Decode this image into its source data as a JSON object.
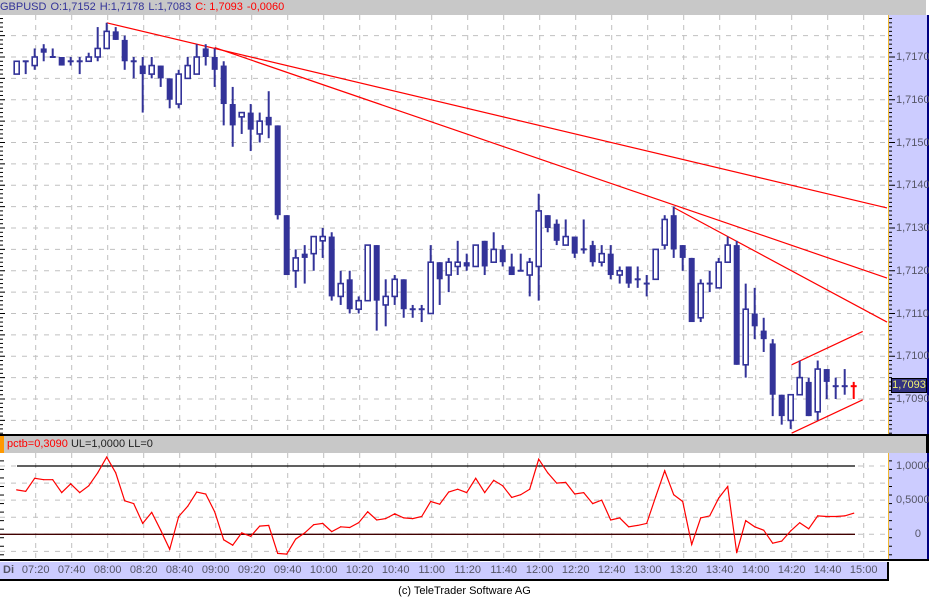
{
  "header": {
    "symbol": "GBPUSD",
    "open": "O:1,7152",
    "high": "H:1,7178",
    "low": "L:1,7083",
    "close": "C: 1,7093",
    "change": "-0,0060"
  },
  "price_axis": {
    "levels": [
      1.709,
      1.71,
      1.711,
      1.712,
      1.713,
      1.714,
      1.715,
      1.716,
      1.717
    ],
    "labels": [
      "1,7090",
      "1,7100",
      "1,7110",
      "1,7120",
      "1,7130",
      "1,7140",
      "1,7150",
      "1,7160",
      "1,7170"
    ],
    "current_value": 1.7093,
    "current_label": "1,7093"
  },
  "indicator": {
    "name_value": "pctb=0,3090",
    "params": "UL=1,0000 LL=0",
    "axis_levels": [
      1,
      0.5,
      0
    ],
    "axis_labels": [
      "1,0000",
      "0,5000",
      "0"
    ],
    "upper_limit": 1,
    "lower_limit": 0
  },
  "time_axis": {
    "day": "Di",
    "labels": [
      "07:20",
      "07:40",
      "08:00",
      "08:20",
      "08:40",
      "09:00",
      "09:20",
      "09:40",
      "10:00",
      "10:20",
      "10:40",
      "11:00",
      "11:20",
      "11:40",
      "12:00",
      "12:20",
      "12:40",
      "13:00",
      "13:20",
      "13:40",
      "14:00",
      "14:20",
      "14:40",
      "15:00"
    ]
  },
  "footer": "(c) TeleTrader Software AG",
  "colors": {
    "candle": "#333399",
    "last_candle": "#ff0000",
    "trendline": "#ff0000",
    "indicator_line": "#ff0000",
    "axis_bg": "#ccccff"
  },
  "chart_data": {
    "type": "candlestick",
    "symbol": "GBPUSD",
    "interval_minutes": 5,
    "first_bar_time": "07:10",
    "ylim": [
      1.708,
      1.7182
    ],
    "ohlc": [
      [
        1.7166,
        1.7169,
        1.7166,
        1.7169
      ],
      [
        1.7169,
        1.7169,
        1.7166,
        1.7169
      ],
      [
        1.7168,
        1.7172,
        1.7167,
        1.717
      ],
      [
        1.7172,
        1.7173,
        1.7169,
        1.7171
      ],
      [
        1.717,
        1.7172,
        1.717,
        1.717
      ],
      [
        1.717,
        1.717,
        1.7168,
        1.7168
      ],
      [
        1.7169,
        1.717,
        1.7168,
        1.7169
      ],
      [
        1.7169,
        1.717,
        1.7166,
        1.7169
      ],
      [
        1.7169,
        1.7171,
        1.7169,
        1.717
      ],
      [
        1.717,
        1.7177,
        1.7169,
        1.7172
      ],
      [
        1.7172,
        1.7178,
        1.7172,
        1.7176
      ],
      [
        1.7176,
        1.7177,
        1.7174,
        1.7174
      ],
      [
        1.7174,
        1.7175,
        1.7167,
        1.7169
      ],
      [
        1.7169,
        1.717,
        1.7165,
        1.7169
      ],
      [
        1.7168,
        1.717,
        1.7157,
        1.7166
      ],
      [
        1.7166,
        1.717,
        1.7165,
        1.7168
      ],
      [
        1.7168,
        1.7168,
        1.7163,
        1.7165
      ],
      [
        1.7165,
        1.7165,
        1.7158,
        1.716
      ],
      [
        1.7159,
        1.7167,
        1.7158,
        1.7166
      ],
      [
        1.7165,
        1.717,
        1.7165,
        1.7168
      ],
      [
        1.7166,
        1.7173,
        1.7166,
        1.717
      ],
      [
        1.7172,
        1.7173,
        1.7168,
        1.717
      ],
      [
        1.717,
        1.7172,
        1.7163,
        1.7167
      ],
      [
        1.7168,
        1.7169,
        1.7154,
        1.7159
      ],
      [
        1.7159,
        1.7163,
        1.7149,
        1.7154
      ],
      [
        1.7156,
        1.7157,
        1.7152,
        1.7157
      ],
      [
        1.7157,
        1.7159,
        1.7148,
        1.7153
      ],
      [
        1.7152,
        1.7157,
        1.715,
        1.7155
      ],
      [
        1.7156,
        1.7162,
        1.7151,
        1.7154
      ],
      [
        1.7154,
        1.7154,
        1.7132,
        1.7133
      ],
      [
        1.7133,
        1.7133,
        1.7119,
        1.7119
      ],
      [
        1.712,
        1.7125,
        1.7116,
        1.7123
      ],
      [
        1.7124,
        1.7126,
        1.7117,
        1.7123
      ],
      [
        1.7124,
        1.7128,
        1.712,
        1.7128
      ],
      [
        1.7127,
        1.713,
        1.7123,
        1.7128
      ],
      [
        1.7128,
        1.7129,
        1.7113,
        1.7114
      ],
      [
        1.7114,
        1.712,
        1.7112,
        1.7117
      ],
      [
        1.7118,
        1.712,
        1.711,
        1.7111
      ],
      [
        1.7111,
        1.7114,
        1.711,
        1.7113
      ],
      [
        1.7113,
        1.7126,
        1.7113,
        1.7126
      ],
      [
        1.7126,
        1.7126,
        1.7106,
        1.7113
      ],
      [
        1.7112,
        1.7118,
        1.7107,
        1.7114
      ],
      [
        1.7114,
        1.7119,
        1.7112,
        1.7118
      ],
      [
        1.7118,
        1.7118,
        1.7109,
        1.7111
      ],
      [
        1.7111,
        1.7112,
        1.7109,
        1.7111
      ],
      [
        1.7111,
        1.7112,
        1.7108,
        1.7111
      ],
      [
        1.711,
        1.7126,
        1.711,
        1.7122
      ],
      [
        1.7122,
        1.7122,
        1.7112,
        1.7118
      ],
      [
        1.7119,
        1.7123,
        1.7115,
        1.7122
      ],
      [
        1.7121,
        1.7127,
        1.7119,
        1.7122
      ],
      [
        1.7122,
        1.7124,
        1.712,
        1.7121
      ],
      [
        1.7121,
        1.7126,
        1.7121,
        1.7126
      ],
      [
        1.7127,
        1.7127,
        1.7119,
        1.7121
      ],
      [
        1.7122,
        1.7129,
        1.7122,
        1.7125
      ],
      [
        1.7125,
        1.7126,
        1.7121,
        1.7122
      ],
      [
        1.7121,
        1.7124,
        1.7119,
        1.7119
      ],
      [
        1.712,
        1.7124,
        1.712,
        1.712
      ],
      [
        1.7119,
        1.7123,
        1.7114,
        1.7122
      ],
      [
        1.7121,
        1.7138,
        1.7113,
        1.7134
      ],
      [
        1.7133,
        1.7133,
        1.7129,
        1.713
      ],
      [
        1.7131,
        1.7132,
        1.7126,
        1.7127
      ],
      [
        1.7126,
        1.7132,
        1.7126,
        1.7128
      ],
      [
        1.7128,
        1.7128,
        1.7123,
        1.7124
      ],
      [
        1.7125,
        1.7132,
        1.7124,
        1.7125
      ],
      [
        1.7126,
        1.7127,
        1.7121,
        1.7122
      ],
      [
        1.7122,
        1.7126,
        1.7121,
        1.7124
      ],
      [
        1.7124,
        1.7126,
        1.7118,
        1.7119
      ],
      [
        1.7119,
        1.7121,
        1.7117,
        1.712
      ],
      [
        1.7121,
        1.7121,
        1.7116,
        1.7117
      ],
      [
        1.7118,
        1.7121,
        1.7116,
        1.7118
      ],
      [
        1.7117,
        1.7119,
        1.7114,
        1.7117
      ],
      [
        1.7118,
        1.7125,
        1.7118,
        1.7125
      ],
      [
        1.7126,
        1.7133,
        1.7125,
        1.7132
      ],
      [
        1.7133,
        1.7135,
        1.7123,
        1.7125
      ],
      [
        1.7126,
        1.7126,
        1.712,
        1.7123
      ],
      [
        1.7123,
        1.7123,
        1.7108,
        1.7108
      ],
      [
        1.7109,
        1.7118,
        1.7108,
        1.7117
      ],
      [
        1.7117,
        1.712,
        1.7115,
        1.7117
      ],
      [
        1.7116,
        1.7123,
        1.7116,
        1.7122
      ],
      [
        1.7122,
        1.7128,
        1.7122,
        1.7126
      ],
      [
        1.7126,
        1.7127,
        1.7098,
        1.7098
      ],
      [
        1.7098,
        1.7117,
        1.7095,
        1.7111
      ],
      [
        1.711,
        1.7116,
        1.7104,
        1.7107
      ],
      [
        1.7106,
        1.7109,
        1.7101,
        1.7104
      ],
      [
        1.7103,
        1.7104,
        1.7086,
        1.7091
      ],
      [
        1.7091,
        1.7091,
        1.7084,
        1.7086
      ],
      [
        1.7085,
        1.7091,
        1.7083,
        1.7091
      ],
      [
        1.7091,
        1.7099,
        1.7091,
        1.7095
      ],
      [
        1.7094,
        1.7095,
        1.7086,
        1.7086
      ],
      [
        1.7087,
        1.7099,
        1.7085,
        1.7097
      ],
      [
        1.7097,
        1.7097,
        1.709,
        1.7094
      ],
      [
        1.7093,
        1.7095,
        1.709,
        1.7093
      ],
      [
        1.7093,
        1.7097,
        1.7091,
        1.7093
      ],
      [
        1.7093,
        1.7094,
        1.709,
        1.7093
      ]
    ],
    "trendlines": [
      {
        "from": [
          10,
          1.7178
        ],
        "to": [
          96.7,
          1.71347
        ]
      },
      {
        "from": [
          22,
          1.71722
        ],
        "to": [
          96.7,
          1.71183
        ]
      },
      {
        "from": [
          73,
          1.71348
        ],
        "to": [
          96.7,
          1.7108
        ]
      },
      {
        "from": [
          86.1,
          1.7098
        ],
        "to": [
          94.0,
          1.71058
        ]
      },
      {
        "from": [
          86.1,
          1.7082
        ],
        "to": [
          94.0,
          1.70898
        ]
      }
    ],
    "pctb": [
      0.65,
      0.63,
      0.82,
      0.8,
      0.8,
      0.61,
      0.74,
      0.61,
      0.71,
      0.9,
      1.13,
      0.9,
      0.49,
      0.45,
      0.16,
      0.32,
      0.06,
      -0.22,
      0.26,
      0.41,
      0.62,
      0.59,
      0.33,
      -0.08,
      -0.16,
      0.02,
      -0.03,
      0.12,
      0.13,
      -0.28,
      -0.29,
      -0.07,
      0.02,
      0.14,
      0.16,
      0.04,
      0.11,
      0.1,
      0.17,
      0.33,
      0.21,
      0.23,
      0.3,
      0.24,
      0.23,
      0.26,
      0.48,
      0.44,
      0.62,
      0.66,
      0.61,
      0.82,
      0.61,
      0.79,
      0.71,
      0.54,
      0.58,
      0.66,
      1.1,
      0.9,
      0.75,
      0.76,
      0.59,
      0.61,
      0.45,
      0.5,
      0.21,
      0.24,
      0.11,
      0.13,
      0.16,
      0.55,
      0.93,
      0.58,
      0.48,
      -0.15,
      0.24,
      0.27,
      0.53,
      0.7,
      -0.27,
      0.2,
      0.11,
      0.06,
      -0.13,
      -0.1,
      0.05,
      0.17,
      0.08,
      0.27,
      0.26,
      0.26,
      0.27,
      0.309
    ],
    "indicator_ylim": [
      -0.3,
      1.2
    ]
  }
}
